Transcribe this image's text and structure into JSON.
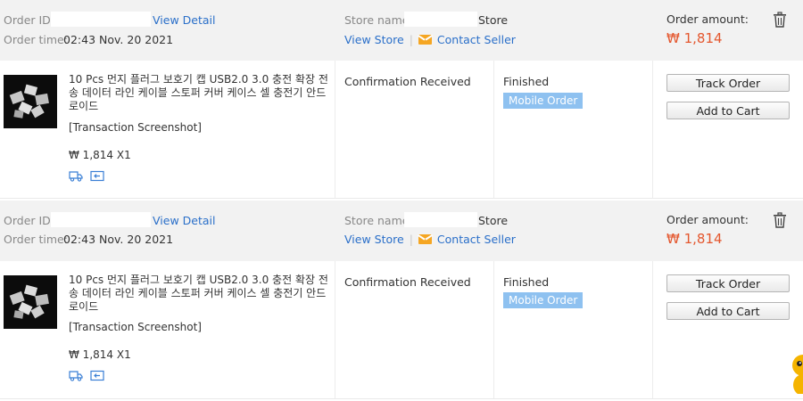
{
  "orders": [
    {
      "order_id_label": "Order ID:",
      "view_detail": "View Detail",
      "order_time_label": "Order time:",
      "order_time": "02:43 Nov. 20 2021",
      "store_name_label": "Store name:",
      "store_suffix": "Store",
      "view_store": "View Store",
      "separator": "|",
      "contact_seller": "Contact Seller",
      "order_amount_label": "Order amount:",
      "order_amount": "₩ 1,814",
      "product_title": "10 Pcs 먼지 플러그 보호기 캡 USB2.0 3.0 충전 확장 전송 데이터 라인 케이블 스토퍼 커버 케이스 셀 충전기 안드로이드",
      "transaction_screenshot": "[Transaction Screenshot]",
      "price_qty": "₩ 1,814 X1",
      "delivery_status": "Confirmation Received",
      "order_status": "Finished",
      "badge": "Mobile Order",
      "track_order": "Track Order",
      "add_to_cart": "Add to Cart"
    },
    {
      "order_id_label": "Order ID:",
      "view_detail": "View Detail",
      "order_time_label": "Order time:",
      "order_time": "02:43 Nov. 20 2021",
      "store_name_label": "Store name:",
      "store_suffix": "Store",
      "view_store": "View Store",
      "separator": "|",
      "contact_seller": "Contact Seller",
      "order_amount_label": "Order amount:",
      "order_amount": "₩ 1,814",
      "product_title": "10 Pcs 먼지 플러그 보호기 캡 USB2.0 3.0 충전 확장 전송 데이터 라인 케이블 스토퍼 커버 케이스 셀 충전기 안드로이드",
      "transaction_screenshot": "[Transaction Screenshot]",
      "price_qty": "₩ 1,814 X1",
      "delivery_status": "Confirmation Received",
      "order_status": "Finished",
      "badge": "Mobile Order",
      "track_order": "Track Order",
      "add_to_cart": "Add to Cart"
    }
  ],
  "colors": {
    "link": "#2a6fc9",
    "amount": "#e4572e",
    "badge": "#8ec1f0",
    "header_bg": "#f2f2f2",
    "mail_icon": "#f5a623"
  },
  "icons": [
    "trash-icon",
    "mail-icon",
    "delivery-truck-icon",
    "return-icon",
    "mascot-icon"
  ]
}
